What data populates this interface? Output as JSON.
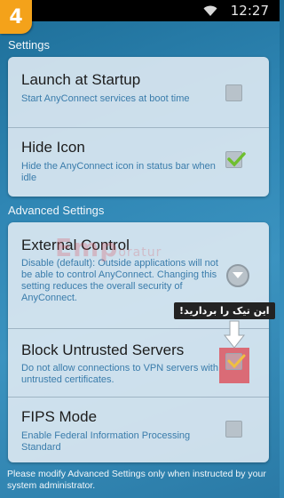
{
  "statusbar": {
    "time": "12:27",
    "icon": "wifi-icon"
  },
  "step_badge": "4",
  "settings_section": {
    "header": "Settings",
    "items": [
      {
        "title": "Launch at Startup",
        "description": "Start AnyConnect services at boot time",
        "checked": false
      },
      {
        "title": "Hide Icon",
        "description": "Hide the AnyConnect icon in status bar when idle",
        "checked": true
      }
    ]
  },
  "advanced_section": {
    "header": "Advanced Settings",
    "items": [
      {
        "title": "External Control",
        "description": "Disable (default): Outside applications will not be able to control AnyConnect. Changing this setting reduces the overall security of AnyConnect.",
        "control": "chevron-down-icon"
      },
      {
        "title": "Block Untrusted Servers",
        "description": "Do not allow connections to VPN servers with untrusted certificates.",
        "checked": true
      },
      {
        "title": "FIPS Mode",
        "description": "Enable Federal Information Processing Standard",
        "checked": false
      }
    ]
  },
  "annotation": {
    "text": "این تیک را بردارید!"
  },
  "footer": "Please modify Advanced Settings only when instructed by your system administrator.",
  "colors": {
    "accent": "#f4a21a",
    "check": "#6fbf2f",
    "highlight": "#de4a54"
  }
}
